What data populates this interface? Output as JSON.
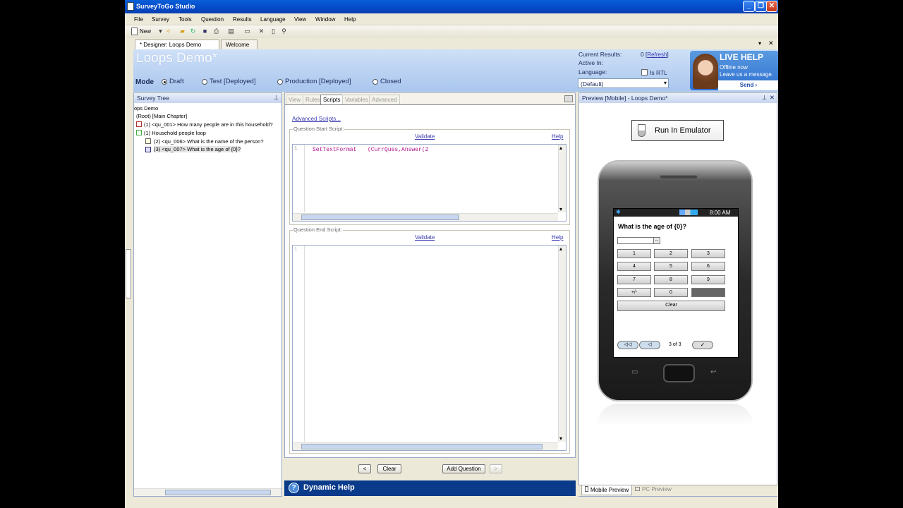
{
  "window": {
    "title": "SurveyToGo Studio"
  },
  "menu": [
    "File",
    "Survey",
    "Tools",
    "Question",
    "Results",
    "Language",
    "View",
    "Window",
    "Help"
  ],
  "toolbar": {
    "new_label": "New"
  },
  "doc_tabs": [
    {
      "label": "* Designer: Loops Demo"
    },
    {
      "label": "Welcome"
    }
  ],
  "header": {
    "title": "Loops Demo*",
    "mode_label": "Mode",
    "modes": [
      {
        "label": "Draft",
        "selected": true
      },
      {
        "label": "Test [Deployed]",
        "selected": false
      },
      {
        "label": "Production [Deployed]",
        "selected": false
      },
      {
        "label": "Closed",
        "selected": false
      }
    ],
    "current_results_label": "Current Results:",
    "current_results_value": "0",
    "refresh_label": "Refresh",
    "active_in_label": "Active In:",
    "language_label": "Language:",
    "is_rtl_label": "Is RTL",
    "language_value": "(Default)"
  },
  "live_help": {
    "title": "LIVE HELP",
    "line1": "Offline now",
    "line2": "Leave us a message.",
    "send": "Send ›"
  },
  "survey_tree": {
    "title": "Survey Tree",
    "items": [
      "ops Demo",
      "(Root) [Main Chapter]",
      "(1) <qu_001> How many people are in this household?",
      "(1) Household people loop",
      "(2) <qu_006> What is the name of the person?",
      "(3) <qu_007> What is the age of {0}?"
    ]
  },
  "sub_tabs": [
    "View",
    "Rules",
    "Scripts",
    "Variables",
    "Advanced"
  ],
  "scripts": {
    "advanced_link": "Advanced Scripts...",
    "start_title": "Question Start Script:",
    "end_title": "Question End Script:",
    "validate": "Validate",
    "help": "Help",
    "line_no": "1",
    "start_code_fn": "SetTextFormat",
    "start_code_rest": "(CurrQues,Answer(2"
  },
  "nav_buttons": {
    "prev": "<",
    "clear": "Clear",
    "add_question": "Add Question",
    "next": ">"
  },
  "dynamic_help": {
    "label": "Dynamic Help"
  },
  "preview": {
    "title": "Preview [Mobile] - Loops Demo*",
    "run_emulator": "Run In Emulator",
    "phone_time": "8:00 AM",
    "question": "What is the age of {0}?",
    "keys": [
      "1",
      "2",
      "3",
      "4",
      "5",
      "6",
      "7",
      "8",
      "9",
      "+/-",
      "0",
      ""
    ],
    "clear_key": "Clear",
    "page_indicator": "3 of 3"
  },
  "bottom_tabs": [
    "Mobile Preview",
    "PC Preview"
  ],
  "colors": {
    "accent": "#0a3a8a",
    "header_bg": "#bcd3f2",
    "code_magenta": "#b0108a"
  }
}
